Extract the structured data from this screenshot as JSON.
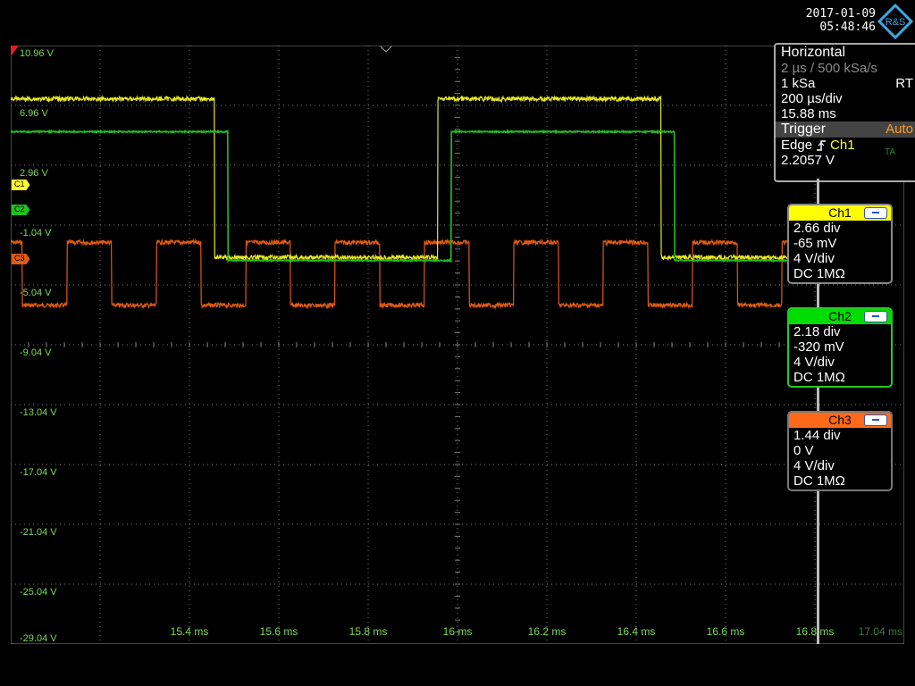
{
  "header": {
    "date": "2017-01-09",
    "time": "05:48:46",
    "logo_text": "R&S"
  },
  "y_axis": {
    "labels": [
      "10.96 V",
      "6.96 V",
      "2.96 V",
      "-1.04 V",
      "-5.04 V",
      "-9.04 V",
      "-13.04 V",
      "-17.04 V",
      "-21.04 V",
      "-25.04 V",
      "-29.04 V"
    ],
    "top": 10.96,
    "bottom": -29.04,
    "step": 4
  },
  "x_axis": {
    "labels": [
      "15.4 ms",
      "15.6 ms",
      "15.8 ms",
      "16 ms",
      "16.2 ms",
      "16.4 ms",
      "16.6 ms",
      "16.8 ms",
      "17.04 ms"
    ],
    "start": 15.04,
    "end": 17.04,
    "step": 0.2
  },
  "horizontal": {
    "title": "Horizontal",
    "rate": "2 µs / 500 kSa/s",
    "record": "1 kSa",
    "mode": "RT",
    "timebase": "200 µs/div",
    "position": "15.88 ms"
  },
  "trigger": {
    "title": "Trigger",
    "mode": "Auto",
    "type": "Edge",
    "source": "Ch1",
    "level": "2.2057 V",
    "marker": "TA"
  },
  "channels": [
    {
      "name": "Ch1",
      "offset_div": "2.66 div",
      "offset_v": "-65 mV",
      "scale": "4 V/div",
      "coupling": "DC 1MΩ",
      "color": "#ffff00",
      "header_text": "#000000",
      "marker": "C1"
    },
    {
      "name": "Ch2",
      "offset_div": "2.18 div",
      "offset_v": "-320 mV",
      "scale": "4 V/div",
      "coupling": "DC 1MΩ",
      "color": "#00dd00",
      "header_text": "#000000",
      "marker": "C2"
    },
    {
      "name": "Ch3",
      "offset_div": "1.44 div",
      "offset_v": "0 V",
      "scale": "4 V/div",
      "coupling": "DC 1MΩ",
      "color": "#ff6a1a",
      "header_text": "#000000",
      "marker": "C3"
    }
  ],
  "colors": {
    "grid": "#7a7a7a",
    "axis_label": "#7ed957",
    "ch1": "#e8e820",
    "ch2": "#20c020",
    "ch3": "#e05a10"
  },
  "waveforms": {
    "ch1": {
      "high_v": 7.4,
      "low_v": -3.2,
      "edges_ms": [
        15.496,
        15.996,
        16.496
      ],
      "start_high": true
    },
    "ch2": {
      "high_v": 5.2,
      "low_v": -3.4,
      "edges_ms": [
        15.526,
        16.026,
        16.526
      ],
      "start_high": true
    },
    "ch3": {
      "high_v": -2.2,
      "low_v": -6.4,
      "period_ms": 0.2,
      "first_fall_ms": 15.266,
      "duty": 0.5
    }
  }
}
